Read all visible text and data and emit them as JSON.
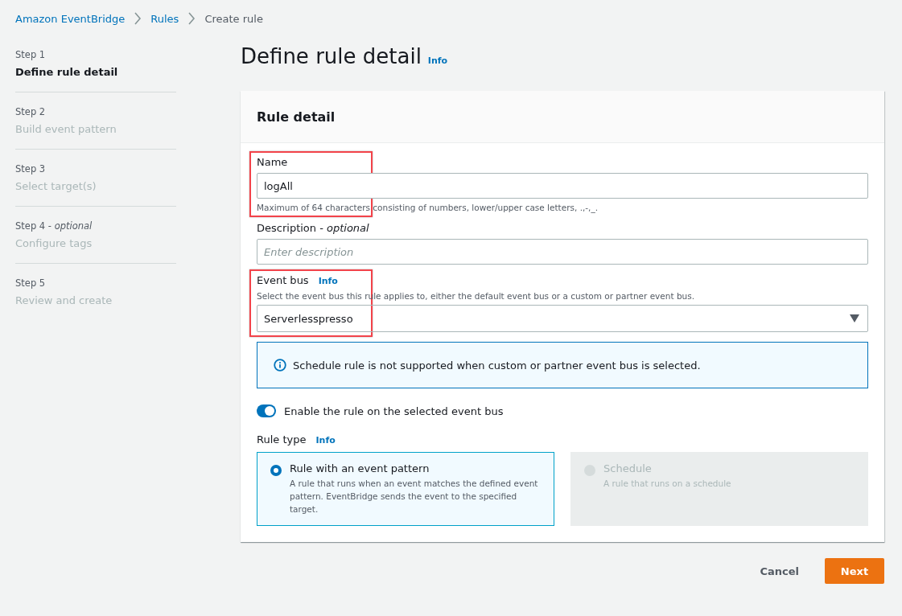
{
  "breadcrumbs": [
    {
      "label": "Amazon EventBridge"
    },
    {
      "label": "Rules"
    },
    {
      "label": "Create rule"
    }
  ],
  "steps": [
    {
      "step": "Step 1",
      "title": "Define rule detail",
      "selected": true
    },
    {
      "step": "Step 2",
      "title": "Build event pattern",
      "selected": false
    },
    {
      "step": "Step 3",
      "title": "Select target(s)",
      "selected": false
    },
    {
      "step": "Step 4 - *optional*",
      "title": "Configure tags",
      "selected": false
    },
    {
      "step": "Step 5",
      "title": "Review and create",
      "selected": false
    }
  ],
  "page": {
    "title": "Define rule detail",
    "info": "Info"
  },
  "card": {
    "title": "Rule detail"
  },
  "name_field": {
    "label": "Name",
    "value": "logAll",
    "hint": "Maximum of 64 characters consisting of numbers, lower/upper case letters, .,-,_.",
    "highlighted": true
  },
  "description_field": {
    "label": "Description - *optional*",
    "placeholder": "Enter description"
  },
  "event_bus": {
    "label": "Event bus",
    "info": "Info",
    "hint": "Select the event bus this rule applies to, either the default event bus or a custom or partner event bus.",
    "value": "Serverlesspresso",
    "highlighted": true
  },
  "alert": {
    "text": "Schedule rule is not supported when custom or partner event bus is selected."
  },
  "enable_toggle": {
    "label": "Enable the rule on the selected event bus",
    "on": true
  },
  "rule_type": {
    "label": "Rule type",
    "info": "Info",
    "options": [
      {
        "title": "Rule with an event pattern",
        "description": "A rule that runs when an event matches the defined event pattern. EventBridge sends the event to the specified target.",
        "selected": true,
        "disabled": false
      },
      {
        "title": "Schedule",
        "description": "A rule that runs on a schedule",
        "selected": false,
        "disabled": true
      }
    ]
  },
  "buttons": {
    "cancel": "Cancel",
    "next": "Next"
  }
}
